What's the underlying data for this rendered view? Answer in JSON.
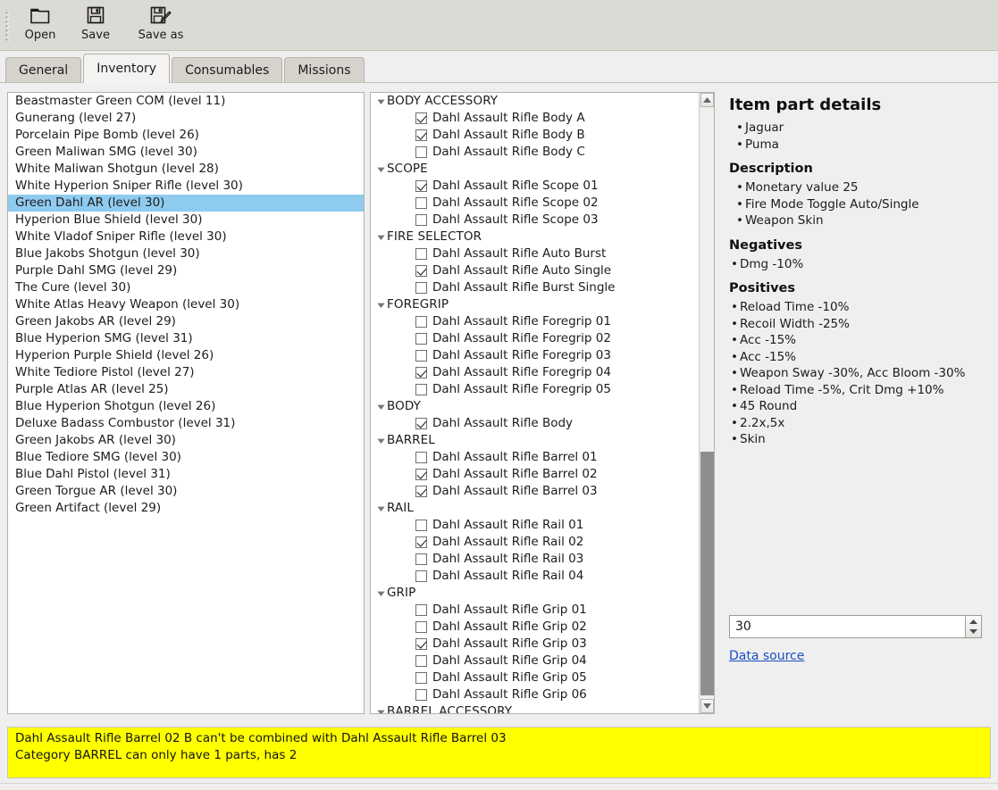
{
  "toolbar": {
    "buttons": [
      {
        "label": "Open",
        "icon": "folder-open-icon"
      },
      {
        "label": "Save",
        "icon": "floppy-disk-icon"
      },
      {
        "label": "Save as",
        "icon": "floppy-disk-pencil-icon"
      }
    ]
  },
  "tabs": [
    {
      "label": "General",
      "active": false
    },
    {
      "label": "Inventory",
      "active": true
    },
    {
      "label": "Consumables",
      "active": false
    },
    {
      "label": "Missions",
      "active": false
    }
  ],
  "inventory_list": {
    "selected_index": 6,
    "items": [
      "Beastmaster Green COM (level 11)",
      "Gunerang (level 27)",
      "Porcelain Pipe Bomb (level 26)",
      "Green Maliwan SMG (level 30)",
      "White Maliwan Shotgun (level 28)",
      "White Hyperion Sniper Rifle (level 30)",
      "Green Dahl AR (level 30)",
      "Hyperion Blue Shield (level 30)",
      "White Vladof Sniper Rifle (level 30)",
      "Blue Jakobs Shotgun (level 30)",
      "Purple Dahl SMG (level 29)",
      "The Cure (level 30)",
      "White Atlas Heavy Weapon (level 30)",
      "Green Jakobs AR (level 29)",
      "Blue Hyperion SMG (level 31)",
      "Hyperion Purple Shield (level 26)",
      "White Tediore Pistol (level 27)",
      "Purple Atlas AR (level 25)",
      "Blue Hyperion Shotgun (level 26)",
      "Deluxe Badass Combustor (level 31)",
      "Green Jakobs AR (level 30)",
      "Blue Tediore SMG (level 30)",
      "Blue Dahl Pistol (level 31)",
      "Green Torgue AR (level 30)",
      "Green Artifact (level 29)"
    ]
  },
  "parts_tree": {
    "groups": [
      {
        "label": "BODY ACCESSORY",
        "expanded": true,
        "parts": [
          {
            "label": "Dahl Assault Rifle Body A",
            "checked": true
          },
          {
            "label": "Dahl Assault Rifle Body B",
            "checked": true
          },
          {
            "label": "Dahl Assault Rifle Body C",
            "checked": false
          }
        ]
      },
      {
        "label": "SCOPE",
        "expanded": true,
        "parts": [
          {
            "label": "Dahl Assault Rifle Scope 01",
            "checked": true
          },
          {
            "label": "Dahl Assault Rifle Scope 02",
            "checked": false
          },
          {
            "label": "Dahl Assault Rifle Scope 03",
            "checked": false
          }
        ]
      },
      {
        "label": "FIRE SELECTOR",
        "expanded": true,
        "parts": [
          {
            "label": "Dahl Assault Rifle Auto Burst",
            "checked": false
          },
          {
            "label": "Dahl Assault Rifle Auto Single",
            "checked": true
          },
          {
            "label": "Dahl Assault Rifle Burst Single",
            "checked": false
          }
        ]
      },
      {
        "label": "FOREGRIP",
        "expanded": true,
        "parts": [
          {
            "label": "Dahl Assault Rifle Foregrip 01",
            "checked": false
          },
          {
            "label": "Dahl Assault Rifle Foregrip 02",
            "checked": false
          },
          {
            "label": "Dahl Assault Rifle Foregrip 03",
            "checked": false
          },
          {
            "label": "Dahl Assault Rifle Foregrip 04",
            "checked": true
          },
          {
            "label": "Dahl Assault Rifle Foregrip 05",
            "checked": false
          }
        ]
      },
      {
        "label": "BODY",
        "expanded": true,
        "parts": [
          {
            "label": "Dahl Assault Rifle Body",
            "checked": true
          }
        ]
      },
      {
        "label": "BARREL",
        "expanded": true,
        "parts": [
          {
            "label": "Dahl Assault Rifle Barrel 01",
            "checked": false
          },
          {
            "label": "Dahl Assault Rifle Barrel 02",
            "checked": true
          },
          {
            "label": "Dahl Assault Rifle Barrel 03",
            "checked": true
          }
        ]
      },
      {
        "label": "RAIL",
        "expanded": true,
        "parts": [
          {
            "label": "Dahl Assault Rifle Rail 01",
            "checked": false
          },
          {
            "label": "Dahl Assault Rifle Rail 02",
            "checked": true
          },
          {
            "label": "Dahl Assault Rifle Rail 03",
            "checked": false
          },
          {
            "label": "Dahl Assault Rifle Rail 04",
            "checked": false
          }
        ]
      },
      {
        "label": "GRIP",
        "expanded": true,
        "parts": [
          {
            "label": "Dahl Assault Rifle Grip 01",
            "checked": false
          },
          {
            "label": "Dahl Assault Rifle Grip 02",
            "checked": false
          },
          {
            "label": "Dahl Assault Rifle Grip 03",
            "checked": true
          },
          {
            "label": "Dahl Assault Rifle Grip 04",
            "checked": false
          },
          {
            "label": "Dahl Assault Rifle Grip 05",
            "checked": false
          },
          {
            "label": "Dahl Assault Rifle Grip 06",
            "checked": false
          }
        ]
      },
      {
        "label": "BARREL ACCESSORY",
        "expanded": true,
        "parts": []
      }
    ]
  },
  "details": {
    "title": "Item part details",
    "names": [
      "Jaguar",
      "Puma"
    ],
    "description_heading": "Description",
    "description": [
      "Monetary value 25",
      "Fire Mode Toggle Auto/Single",
      "Weapon Skin"
    ],
    "negatives_heading": "Negatives",
    "negatives": [
      "Dmg -10%"
    ],
    "positives_heading": "Positives",
    "positives": [
      "Reload Time -10%",
      "Recoil Width -25%",
      "Acc -15%",
      "Acc -15%",
      "Weapon Sway -30%, Acc Bloom -30%",
      "Reload Time -5%, Crit Dmg +10%",
      "45 Round",
      "2.2x,5x",
      "Skin"
    ],
    "level_value": "30",
    "data_source_label": "Data source"
  },
  "warnings": [
    "Dahl Assault Rifle Barrel 02 B can't be combined with Dahl Assault Rifle Barrel 03",
    "Category BARREL can only have 1 parts, has 2"
  ],
  "colors": {
    "selection": "#8fcbef",
    "warning_background": "#ffff00",
    "link": "#1a4fc4",
    "window_background": "#efefef",
    "toolbar_background": "#dcdad5"
  }
}
